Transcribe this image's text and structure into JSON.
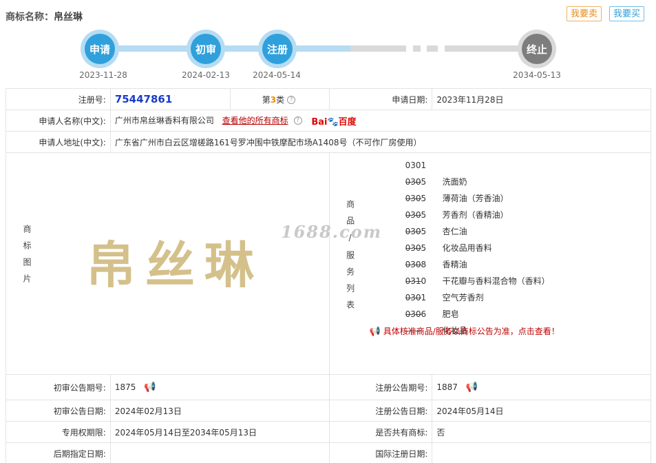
{
  "header": {
    "label": "商标名称：",
    "name": "帛丝琳",
    "sell_button": "我要卖",
    "buy_button": "我要买"
  },
  "timeline": {
    "steps": [
      {
        "label": "申请",
        "date": "2023-11-28",
        "state": "done"
      },
      {
        "label": "初审",
        "date": "2024-02-13",
        "state": "done"
      },
      {
        "label": "注册",
        "date": "2024-05-14",
        "state": "done"
      },
      {
        "label": "终止",
        "date": "2034-05-13",
        "state": "pending"
      }
    ],
    "colors": {
      "done": "#2fa0dc",
      "pending": "#7d7d7d"
    }
  },
  "info": {
    "reg_no_label": "注册号:",
    "reg_no": "75447861",
    "class_prefix": "第",
    "class_num": "3",
    "class_suffix": "类",
    "apply_date_label": "申请日期:",
    "apply_date": "2023年11月28日",
    "applicant_label": "申请人名称(中文):",
    "applicant": "广州市帛丝琳香料有限公司",
    "view_all_link": "查看他的所有商标",
    "baidu_text_1": "Bai",
    "baidu_text_2": "百度",
    "address_label": "申请人地址(中文):",
    "address": "广东省广州市白云区增槎路161号罗冲围中铁摩配市场A1408号（不可作厂房使用）",
    "image_label": "商标图片",
    "logo_text": "帛丝琳",
    "watermark": "1688.com",
    "services_label": "商品/服务列表",
    "services": [
      {
        "code": "0301——",
        "name": "洗面奶"
      },
      {
        "code": "0305——",
        "name": "薄荷油（芳香油）"
      },
      {
        "code": "0305——",
        "name": "芳香剂（香精油）"
      },
      {
        "code": "0305——",
        "name": "杏仁油"
      },
      {
        "code": "0305——",
        "name": "化妆品用香料"
      },
      {
        "code": "0305——",
        "name": "香精油"
      },
      {
        "code": "0308——",
        "name": "干花瓣与香料混合物（香料）"
      },
      {
        "code": "0310——",
        "name": "空气芳香剂"
      },
      {
        "code": "0301——",
        "name": "肥皂"
      },
      {
        "code": "0306——",
        "name": "化妆品"
      }
    ],
    "services_notice": "具体核准商品/服务以商标公告为准，点击查看！",
    "prelim_no_label": "初审公告期号:",
    "prelim_no": "1875",
    "reg_pub_no_label": "注册公告期号:",
    "reg_pub_no": "1887",
    "prelim_date_label": "初审公告日期:",
    "prelim_date": "2024年02月13日",
    "reg_pub_date_label": "注册公告日期:",
    "reg_pub_date": "2024年05月14日",
    "exclusive_label": "专用权期限:",
    "exclusive": "2024年05月14日至2034年05月13日",
    "shared_label": "是否共有商标:",
    "shared": "否",
    "later_label": "后期指定日期:",
    "later": "",
    "intl_label": "国际注册日期:",
    "intl": ""
  }
}
